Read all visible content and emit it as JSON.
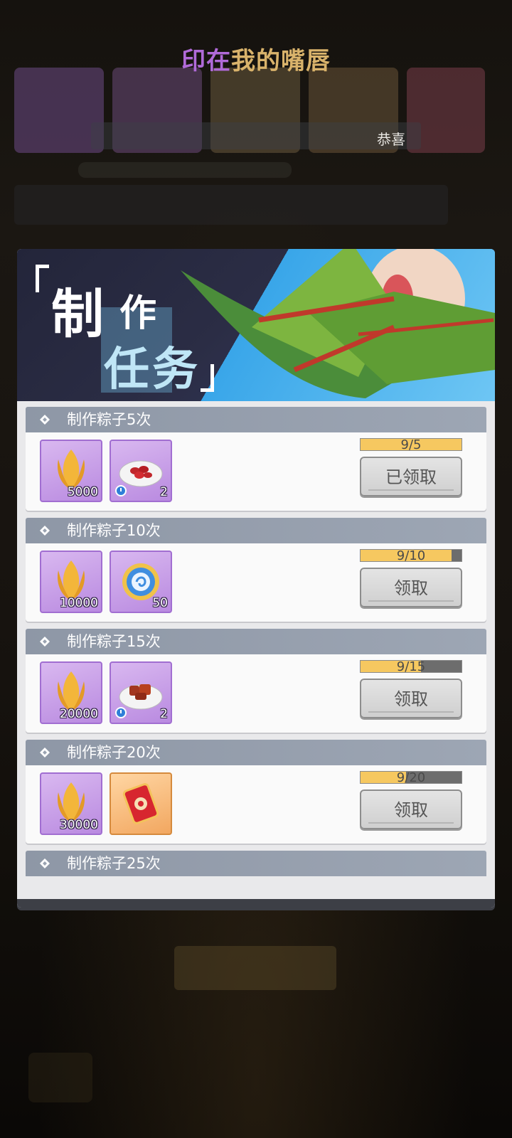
{
  "top_title": {
    "part1": "印在",
    "part2": "我的嘴唇"
  },
  "congrats": "恭喜",
  "banner": {
    "title_big": "制",
    "title_small": "作",
    "title_sub": "任务"
  },
  "tasks": [
    {
      "label": "制作粽子5次",
      "rewards": [
        {
          "icon": "golden-petal-icon",
          "count": "5000",
          "timed": false,
          "rarity": "purple"
        },
        {
          "icon": "red-date-plate-icon",
          "count": "2",
          "timed": true,
          "rarity": "purple"
        }
      ],
      "progress_text": "9/5",
      "progress": 1.0,
      "button": "已领取"
    },
    {
      "label": "制作粽子10次",
      "rewards": [
        {
          "icon": "golden-petal-icon",
          "count": "10000",
          "timed": false,
          "rarity": "purple"
        },
        {
          "icon": "blue-medal-icon",
          "count": "50",
          "timed": false,
          "rarity": "purple"
        }
      ],
      "progress_text": "9/10",
      "progress": 0.9,
      "button": "领取"
    },
    {
      "label": "制作粽子15次",
      "rewards": [
        {
          "icon": "golden-petal-icon",
          "count": "20000",
          "timed": false,
          "rarity": "purple"
        },
        {
          "icon": "braised-meat-plate-icon",
          "count": "2",
          "timed": true,
          "rarity": "purple"
        }
      ],
      "progress_text": "9/15",
      "progress": 0.6,
      "button": "领取"
    },
    {
      "label": "制作粽子20次",
      "rewards": [
        {
          "icon": "golden-petal-icon",
          "count": "30000",
          "timed": false,
          "rarity": "purple"
        },
        {
          "icon": "red-envelope-icon",
          "count": "",
          "timed": false,
          "rarity": "orange"
        }
      ],
      "progress_text": "9/20",
      "progress": 0.45,
      "button": "领取"
    },
    {
      "label": "制作粽子25次"
    }
  ],
  "colors": {
    "accent_purple": "#b06ad8",
    "accent_gold": "#d9b36b",
    "progress_fill": "#f6c860"
  }
}
